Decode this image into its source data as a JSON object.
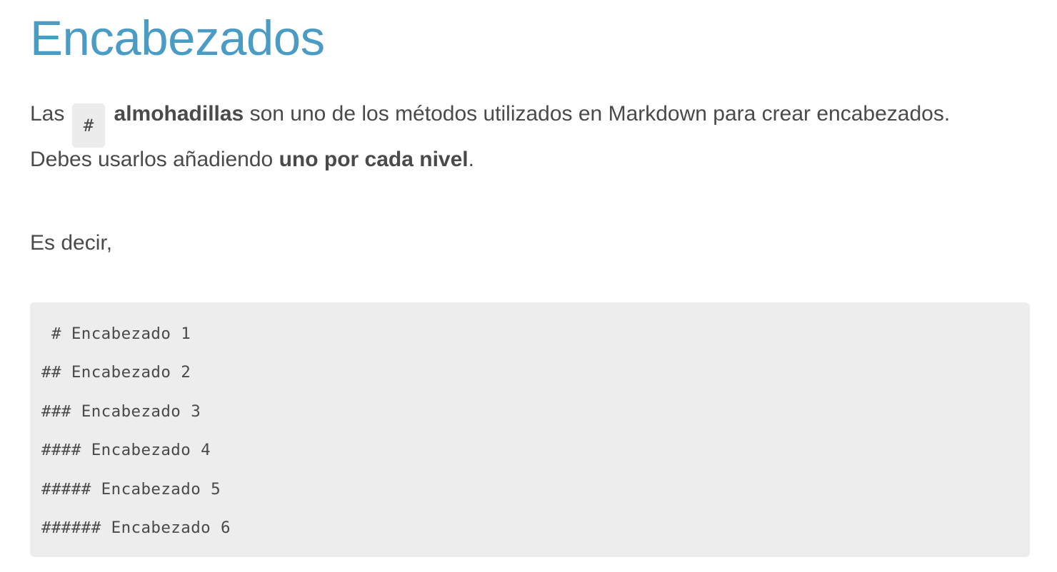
{
  "title": "Encabezados",
  "intro": {
    "prefix": "Las",
    "inline_code": "#",
    "bold_term": "almohadillas",
    "suffix": " son uno de los métodos utilizados en Markdown para crear encabezados.",
    "line2_prefix": "Debes usarlos añadiendo ",
    "line2_bold": "uno por cada nivel",
    "line2_suffix": "."
  },
  "lead_in": "Es decir,",
  "code_block": {
    "lines": [
      " # Encabezado 1",
      "## Encabezado 2",
      "### Encabezado 3",
      "#### Encabezado 4",
      "##### Encabezado 5",
      "###### Encabezado 6"
    ]
  },
  "colors": {
    "title": "#4a9cc4",
    "text": "#4a4a4a",
    "code_background": "#ededed"
  }
}
